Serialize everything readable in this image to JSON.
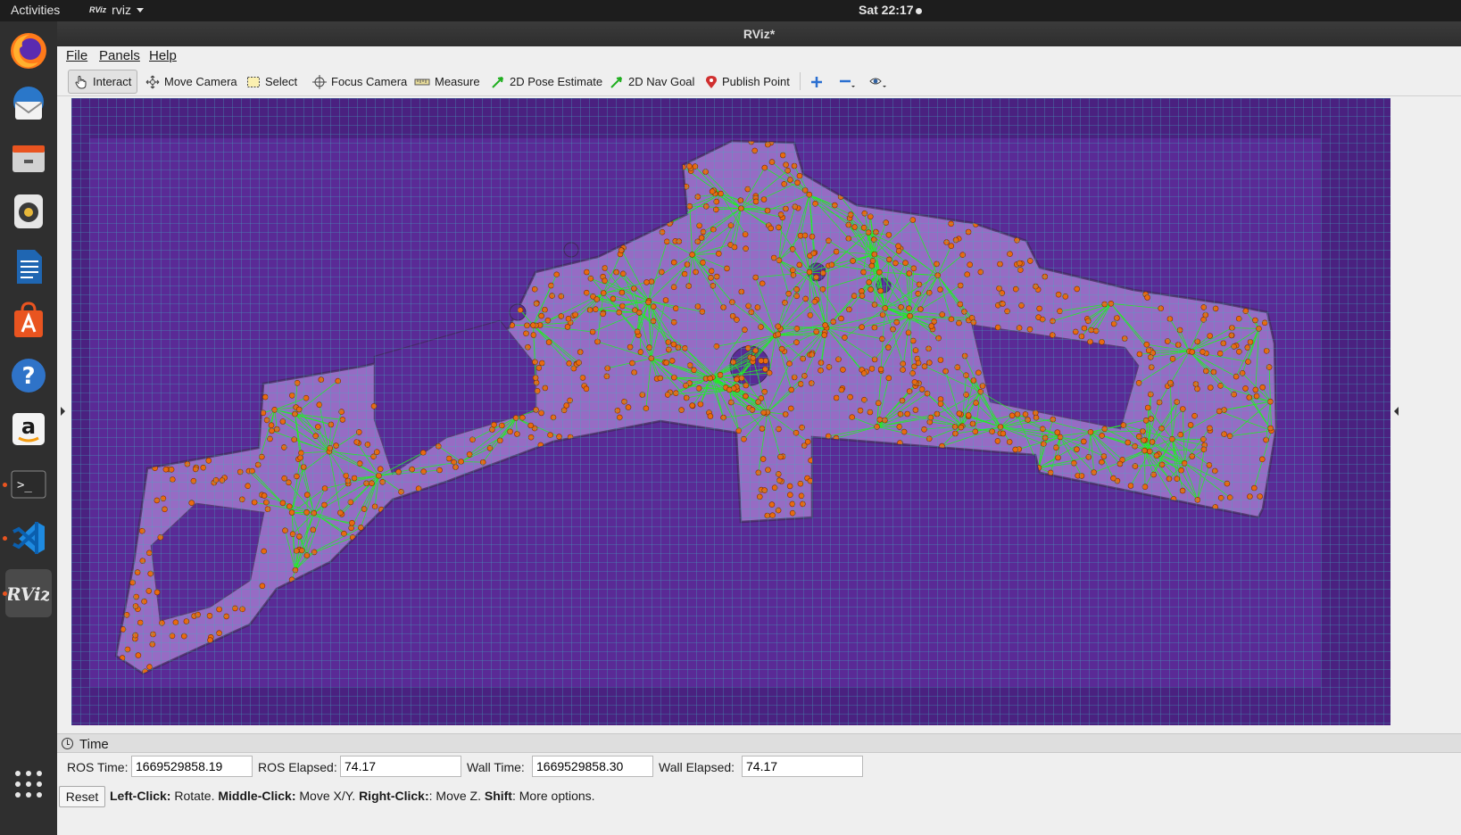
{
  "topbar": {
    "activities": "Activities",
    "app_icon_text": "RViz",
    "app_name": "rviz",
    "clock": "Sat 22:17"
  },
  "dock": {
    "items": [
      "firefox-icon",
      "thunderbird-icon",
      "files-icon",
      "rhythmbox-icon",
      "libreoffice-writer-icon",
      "software-center-icon",
      "help-icon",
      "amazon-icon",
      "terminal-icon",
      "vscode-icon",
      "rviz-icon",
      "show-apps-icon"
    ],
    "rviz_label": "RViz",
    "amazon_letter": "a",
    "help_glyph": "?",
    "terminal_glyph": ">_"
  },
  "window": {
    "title": "RViz*"
  },
  "menu": {
    "file": "File",
    "panels": "Panels",
    "help": "Help"
  },
  "toolbar": {
    "interact": "Interact",
    "move_camera": "Move Camera",
    "select": "Select",
    "focus_camera": "Focus Camera",
    "measure": "Measure",
    "pose_estimate": "2D Pose Estimate",
    "nav_goal": "2D Nav Goal",
    "publish_point": "Publish Point"
  },
  "viewport": {
    "background_color": "#4a2180",
    "grid_color": "#3fb0c0",
    "free_space_color": "#9a70c6",
    "node_color": "#e86a10",
    "edge_color": "#22ee22"
  },
  "time_panel": {
    "title": "Time",
    "ros_time_label": "ROS Time:",
    "ros_time": "1669529858.19",
    "ros_elapsed_label": "ROS Elapsed:",
    "ros_elapsed": "74.17",
    "wall_time_label": "Wall Time:",
    "wall_time": "1669529858.30",
    "wall_elapsed_label": "Wall Elapsed:",
    "wall_elapsed": "74.17",
    "reset": "Reset",
    "hint_left_key": "Left-Click:",
    "hint_left": " Rotate. ",
    "hint_middle_key": "Middle-Click:",
    "hint_middle": " Move X/Y. ",
    "hint_right_key": "Right-Click:",
    "hint_right": ": Move Z. ",
    "hint_shift_key": "Shift",
    "hint_shift": ": More options."
  }
}
